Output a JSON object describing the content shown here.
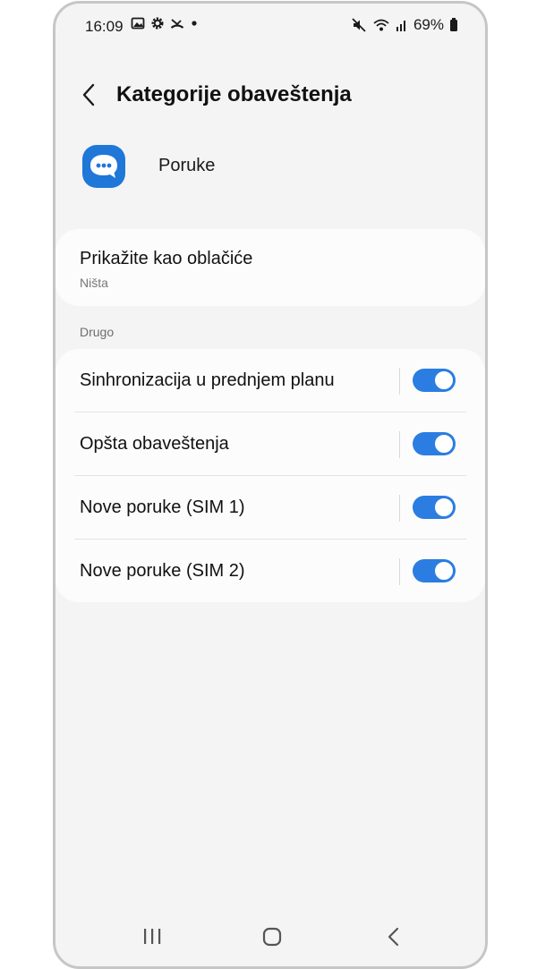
{
  "status_bar": {
    "time": "16:09",
    "battery_percent": "69%",
    "left_icons": [
      "gallery-icon",
      "gear-icon",
      "missed-call-icon",
      "dot-icon"
    ],
    "right_icons": [
      "mute-icon",
      "wifi-icon",
      "signal-icon",
      "battery-icon"
    ]
  },
  "header": {
    "title": "Kategorije obaveštenja",
    "back_icon": "chevron-left-icon"
  },
  "app": {
    "name": "Poruke",
    "icon": "messages-icon",
    "icon_color": "#1f77d8"
  },
  "bubbles": {
    "label": "Prikažite kao oblačiće",
    "value": "Ništa"
  },
  "section_other": {
    "label": "Drugo"
  },
  "channels": [
    {
      "label": "Sinhronizacija u prednjem planu",
      "enabled": true
    },
    {
      "label": "Opšta obaveštenja",
      "enabled": true
    },
    {
      "label": "Nove poruke (SIM 1)",
      "enabled": true
    },
    {
      "label": "Nove poruke (SIM 2)",
      "enabled": true
    }
  ],
  "colors": {
    "accent": "#2b7de1",
    "background": "#f4f4f4",
    "card": "#fcfcfc"
  },
  "nav_bar": {
    "buttons": [
      "recent-apps-icon",
      "home-icon",
      "back-icon"
    ]
  }
}
